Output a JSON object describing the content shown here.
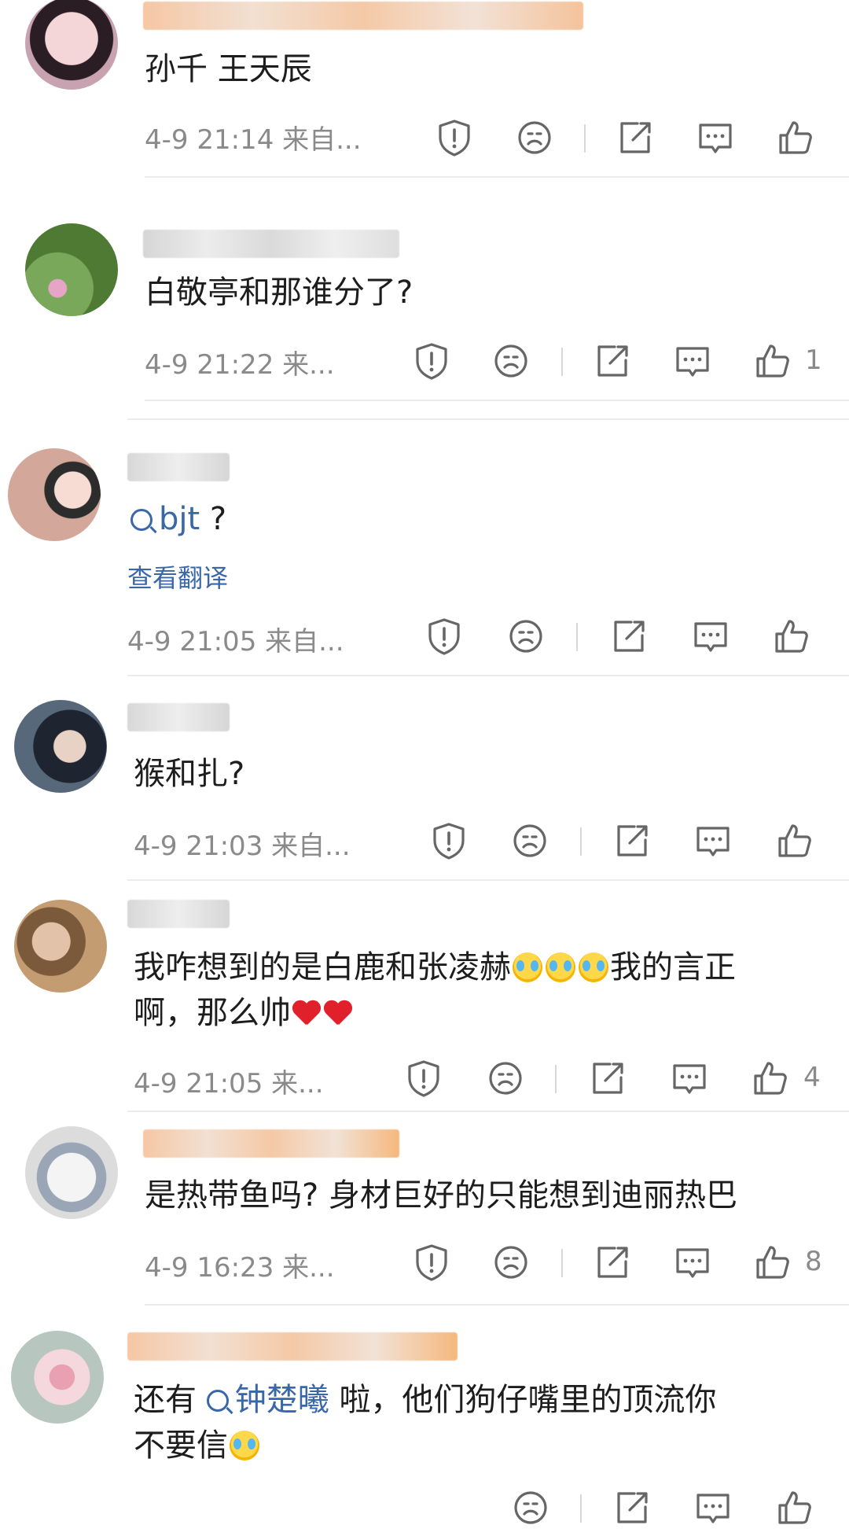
{
  "comments": [
    {
      "text": "孙千 王天辰",
      "meta": "4-9 21:14 来自...",
      "likes": "",
      "avatar_color": "#d9a7b8"
    },
    {
      "text": "白敬亭和那谁分了?",
      "meta": "4-9 21:22 来...",
      "likes": "1",
      "avatar_color": "#6d9a4a"
    },
    {
      "link": "bjt",
      "text_after": "?",
      "translate": "查看翻译",
      "meta": "4-9 21:05 来自...",
      "likes": "",
      "avatar_color": "#c89a8a"
    },
    {
      "text": "猴和扎?",
      "meta": "4-9 21:03 来自...",
      "likes": "",
      "avatar_color": "#3a4a5a"
    },
    {
      "line1_a": "我咋想到的是白鹿和张凌赫",
      "line1_b": "我的言正",
      "line2": "啊，那么帅",
      "meta": "4-9 21:05 来...",
      "likes": "4",
      "avatar_color": "#b5916d"
    },
    {
      "text": "是热带鱼吗? 身材巨好的只能想到迪丽热巴",
      "meta": "4-9 16:23 来...",
      "likes": "8",
      "avatar_color": "#cfcfcf"
    },
    {
      "text_before": "还有",
      "link": "钟楚曦",
      "text_after": "啦，他们狗仔嘴里的顶流你",
      "line2": "不要信",
      "avatar_color": "#e3b9c4"
    }
  ],
  "colors": {
    "link": "#3a67a8",
    "meta": "#8a8a8a",
    "separator": "#ececec"
  }
}
